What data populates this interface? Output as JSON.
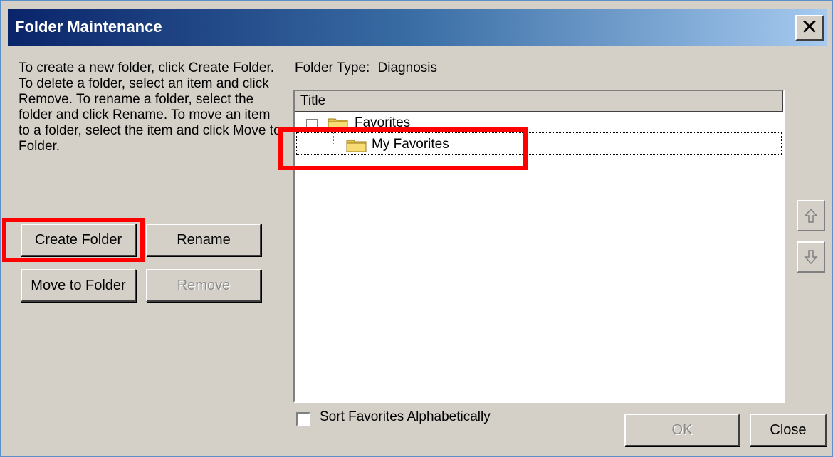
{
  "window": {
    "title": "Folder Maintenance",
    "close_glyph": "✕",
    "close_icon": "close-icon"
  },
  "instructions": {
    "text": "To create a new folder, click Create Folder. To delete a folder, select an item and click Remove. To rename a folder, select the folder and click Rename. To move an item to a folder, select the item and click Move to Folder."
  },
  "buttons": {
    "create_folder": "Create Folder",
    "rename": "Rename",
    "move_to_folder": "Move to Folder",
    "remove": "Remove",
    "ok": "OK",
    "close": "Close"
  },
  "folder_type": {
    "label": "Folder Type:",
    "value": "Diagnosis"
  },
  "tree": {
    "column_header": "Title",
    "items": [
      {
        "label": "Favorites",
        "expanded": true,
        "icon": "folder-icon"
      },
      {
        "label": "My Favorites",
        "selected": true,
        "icon": "folder-icon"
      }
    ]
  },
  "sort_option": {
    "label": "Sort Favorites Alphabetically",
    "checked": false
  },
  "move_buttons": {
    "up_icon": "up-arrow-icon",
    "down_icon": "down-arrow-icon"
  },
  "colors": {
    "highlight": "#ff0000",
    "titlebar_start": "#0a246a",
    "titlebar_end": "#a6caf0"
  }
}
